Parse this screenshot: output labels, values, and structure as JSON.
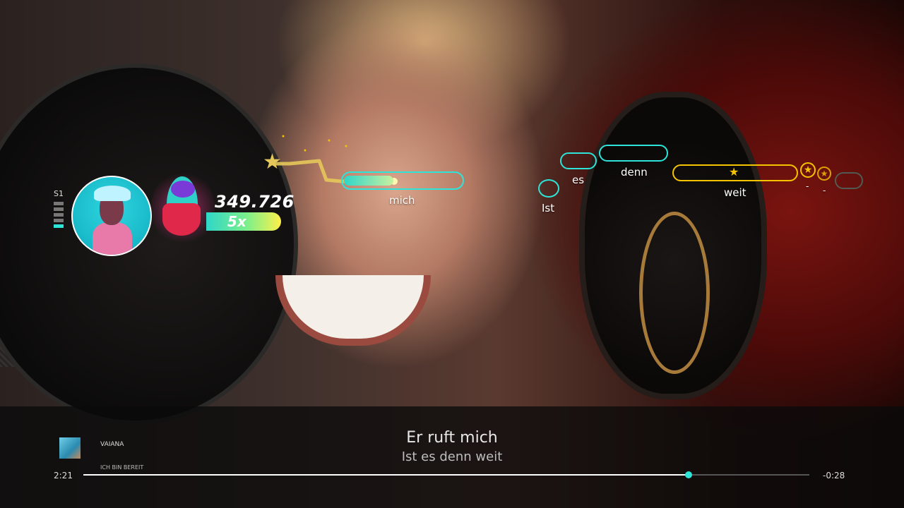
{
  "player": {
    "slot": "S1",
    "score": "349.726",
    "multiplier": "5x",
    "multiplier_fraction": 0.95
  },
  "notes": [
    {
      "word": "mich",
      "type": "normal"
    },
    {
      "word": "Ist",
      "type": "normal"
    },
    {
      "word": "es",
      "type": "normal"
    },
    {
      "word": "denn",
      "type": "normal"
    },
    {
      "word": "weit",
      "type": "golden"
    },
    {
      "word": "-",
      "type": "golden"
    },
    {
      "word": "-",
      "type": "golden"
    }
  ],
  "lyrics": {
    "current": "Er ruft mich",
    "next": "Ist es denn weit"
  },
  "song": {
    "title": "VAIANA",
    "subtitle": "ICH BIN BEREIT",
    "elapsed": "2:21",
    "remaining": "-0:28",
    "progress": 0.834
  },
  "colors": {
    "note_outline": "#2ee4d8",
    "golden_note": "#f5c400",
    "multiplier_start": "#2fd6c8",
    "multiplier_end": "#fff04a",
    "progress_knob": "#2ee4d8"
  },
  "icons": {
    "star": "★"
  }
}
